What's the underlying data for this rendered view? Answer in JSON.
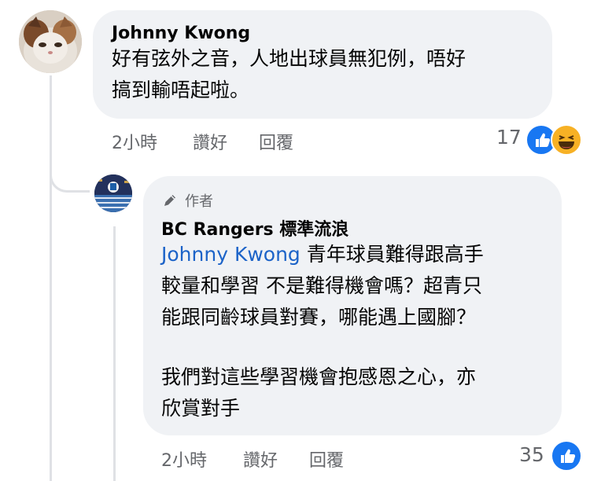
{
  "comment": {
    "author": "Johnny Kwong",
    "lines": [
      "好有弦外之音，人地出球員無犯例，唔好",
      "搞到輸唔起啦。"
    ],
    "time": "2小時",
    "like_label": "讚好",
    "reply_label": "回覆",
    "reaction_count": "17",
    "reactions": [
      "like-icon",
      "haha-icon"
    ],
    "colors": {
      "like": "#1877f2",
      "haha": "#f7b125"
    }
  },
  "reply": {
    "badge": "作者",
    "author": "BC Rangers 標準流浪",
    "mention": "Johnny Kwong",
    "lines": [
      " 青年球員難得跟高手",
      "較量和學習 不是難得機會嗎？超青只",
      "能跟同齡球員對賽，哪能遇上國腳？",
      "",
      "我們對這些學習機會抱感恩之心，亦",
      "欣賞對手"
    ],
    "time": "2小時",
    "like_label": "讚好",
    "reply_label": "回覆",
    "reaction_count": "35",
    "reactions": [
      "like-icon"
    ],
    "colors": {
      "mention": "#1c63c8",
      "bubble": "#f0f2f5"
    }
  }
}
